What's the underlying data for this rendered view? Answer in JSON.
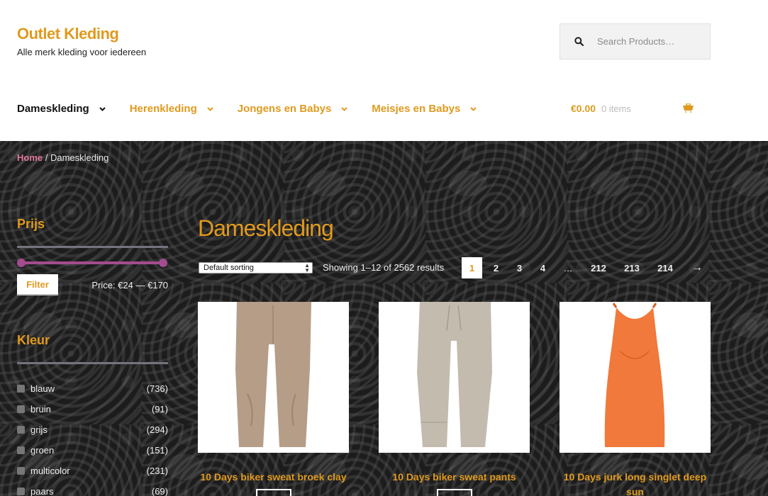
{
  "header": {
    "site_title": "Outlet Kleding",
    "site_description": "Alle merk kleding voor iedereen",
    "search_placeholder": "Search Products…"
  },
  "nav": {
    "items": [
      {
        "label": "Dameskleding",
        "active": true
      },
      {
        "label": "Herenkleding",
        "active": false
      },
      {
        "label": "Jongens en Babys",
        "active": false
      },
      {
        "label": "Meisjes en Babys",
        "active": false
      }
    ]
  },
  "cart": {
    "amount": "€0.00",
    "items": "0 items"
  },
  "breadcrumb": {
    "home": "Home",
    "separator": " / ",
    "current": "Dameskleding"
  },
  "sidebar": {
    "price_widget": {
      "title": "Prijs",
      "filter_label": "Filter",
      "price_range": "Price: €24 — €170",
      "min_fraction": 0,
      "max_fraction": 1
    },
    "color_widget": {
      "title": "Kleur",
      "items": [
        {
          "name": "blauw",
          "count": "(736)"
        },
        {
          "name": "bruin",
          "count": "(91)"
        },
        {
          "name": "grijs",
          "count": "(294)"
        },
        {
          "name": "groen",
          "count": "(151)"
        },
        {
          "name": "multicolor",
          "count": "(231)"
        },
        {
          "name": "paars",
          "count": "(69)"
        }
      ]
    }
  },
  "content": {
    "page_title": "Dameskleding",
    "sort_selected": "Default sorting",
    "result_count": "Showing 1–12 of 2562 results",
    "pagination": [
      "1",
      "2",
      "3",
      "4",
      "…",
      "212",
      "213",
      "214",
      "→"
    ],
    "current_page": "1",
    "products": [
      {
        "title": "10 Days biker sweat broek clay",
        "color": "#b59d87"
      },
      {
        "title": "10 Days biker sweat pants",
        "color": "#c2bbae"
      },
      {
        "title": "10 Days jurk long singlet deep sun",
        "color": "#f0793b"
      }
    ]
  },
  "colors": {
    "accent": "#e09a1e",
    "slider": "#a44c8f",
    "breadcrumb_home": "#e07aa0"
  }
}
